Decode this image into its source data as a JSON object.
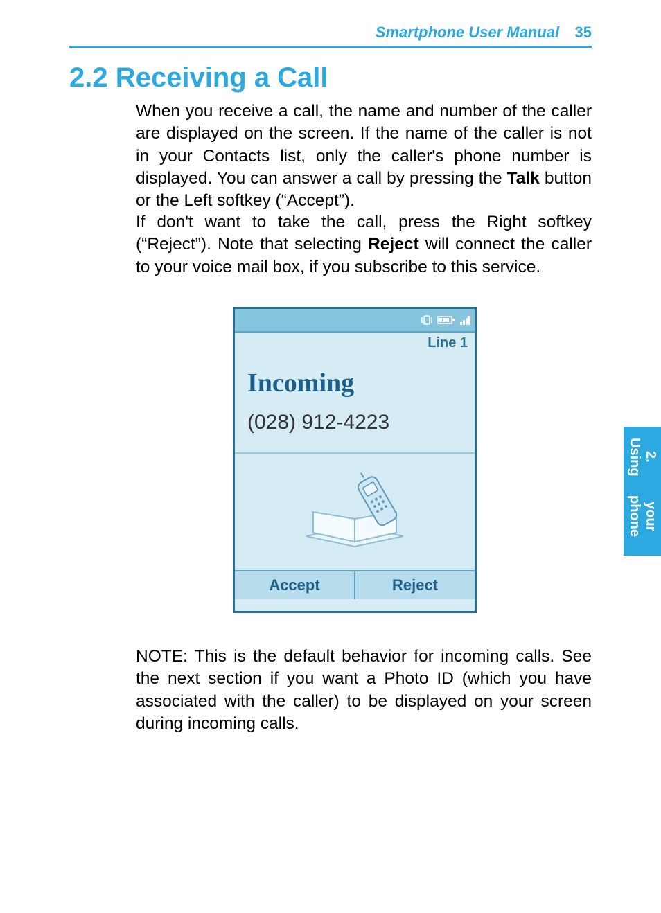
{
  "header": {
    "title": "Smartphone User Manual",
    "page_number": "35"
  },
  "section": {
    "number": "2.2",
    "title": "Receiving a Call"
  },
  "paragraphs": {
    "p1_a": "When you receive a call, the name and number of the caller are displayed on the screen.  If the name of the caller is not in your Contacts list, only the caller's phone number is displayed.  You can answer a call by pressing the ",
    "p1_bold": "Talk",
    "p1_b": " button or the Left softkey (“Accept”).",
    "p2_a": "If don't want to take the call, press the Right softkey (“Reject”).  Note that selecting ",
    "p2_bold": "Reject",
    "p2_b": " will connect the caller to your voice mail box, if you subscribe to this service.",
    "p3": "NOTE:  This is the default behavior for incoming calls.  See the next section if you want a Photo ID (which you have associated with the caller) to be displayed on your screen during incoming calls."
  },
  "phone": {
    "line_label": "Line 1",
    "status_label": "Incoming",
    "caller_number": "(028) 912-4223",
    "softkey_left": "Accept",
    "softkey_right": "Reject"
  },
  "side_tab": {
    "line1": "2. Using",
    "line2": "your phone"
  }
}
